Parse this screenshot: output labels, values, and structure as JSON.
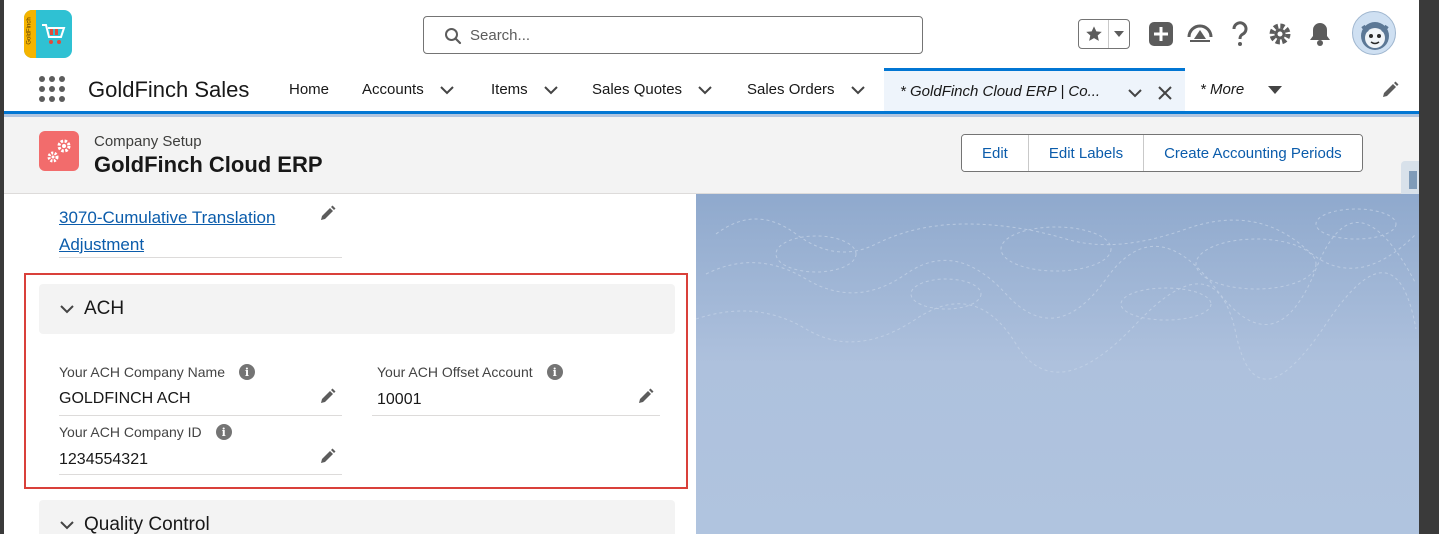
{
  "header": {
    "search_placeholder": "Search...",
    "logo_text": "GoldFinch"
  },
  "nav": {
    "app_name": "GoldFinch Sales",
    "items": [
      {
        "label": "Home"
      },
      {
        "label": "Accounts"
      },
      {
        "label": "Items"
      },
      {
        "label": "Sales Quotes"
      },
      {
        "label": "Sales Orders"
      }
    ],
    "active_tab": "* GoldFinch Cloud ERP | Co...",
    "more": "* More"
  },
  "page_header": {
    "object_label": "Company Setup",
    "record_title": "GoldFinch Cloud ERP",
    "buttons": {
      "edit": "Edit",
      "edit_labels": "Edit Labels",
      "create_periods": "Create Accounting Periods"
    }
  },
  "fields": {
    "translation_adjustment": "3070-Cumulative Translation Adjustment"
  },
  "sections": {
    "ach": {
      "title": "ACH",
      "company_name_label": "Your ACH Company Name",
      "company_name_value": "GOLDFINCH ACH",
      "offset_account_label": "Your ACH Offset Account",
      "offset_account_value": "10001",
      "company_id_label": "Your ACH Company ID",
      "company_id_value": "1234554321"
    },
    "quality_control": {
      "title": "Quality Control"
    }
  },
  "colors": {
    "brand_blue": "#0176d3",
    "link_blue": "#0b5cab",
    "highlight_red": "#d9403a",
    "object_icon": "#f26c6c"
  }
}
